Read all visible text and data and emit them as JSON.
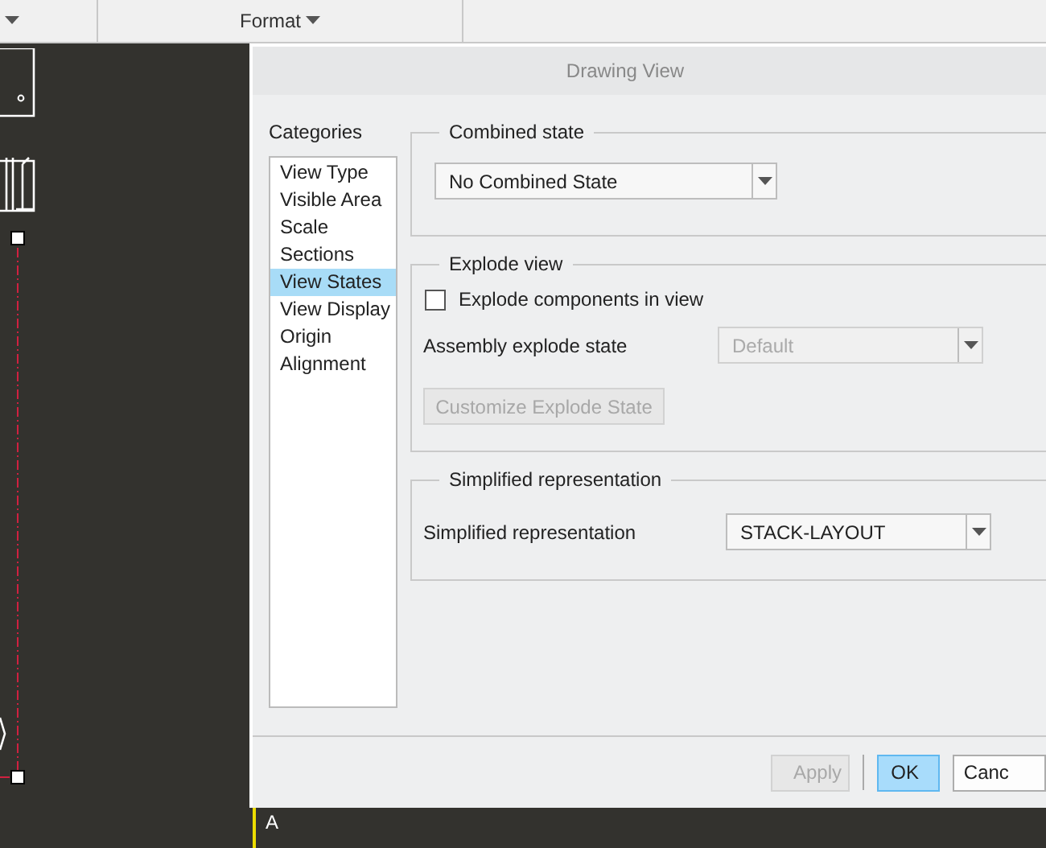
{
  "toolbar": {
    "menu": "Format"
  },
  "canvas": {
    "note_label": "A"
  },
  "dialog": {
    "title": "Drawing View",
    "categories_label": "Categories",
    "categories": [
      {
        "label": "View Type",
        "selected": false
      },
      {
        "label": "Visible Area",
        "selected": false
      },
      {
        "label": "Scale",
        "selected": false
      },
      {
        "label": "Sections",
        "selected": false
      },
      {
        "label": "View States",
        "selected": true
      },
      {
        "label": "View Display",
        "selected": false
      },
      {
        "label": "Origin",
        "selected": false
      },
      {
        "label": "Alignment",
        "selected": false
      }
    ],
    "combined_state": {
      "legend": "Combined state",
      "value": "No Combined State"
    },
    "explode": {
      "legend": "Explode view",
      "checkbox": {
        "label": "Explode components in view",
        "checked": false
      },
      "state_label": "Assembly explode state",
      "state_value": "Default",
      "state_disabled": true,
      "button": "Customize Explode State",
      "button_disabled": true
    },
    "simplified": {
      "legend": "Simplified representation",
      "label": "Simplified representation",
      "value": "STACK-LAYOUT"
    },
    "buttons": [
      {
        "label": "Apply",
        "kind": "default",
        "disabled": true
      },
      {
        "label": "OK",
        "kind": "primary",
        "disabled": false
      },
      {
        "label": "Canc",
        "kind": "default",
        "disabled": false
      }
    ]
  }
}
